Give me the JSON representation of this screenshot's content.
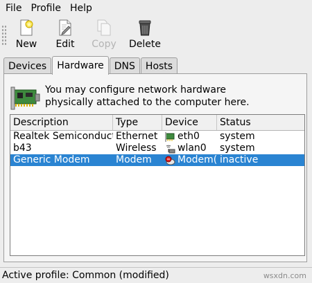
{
  "menubar": {
    "items": [
      "File",
      "Profile",
      "Help"
    ]
  },
  "toolbar": {
    "new": "New",
    "edit": "Edit",
    "copy": "Copy",
    "delete": "Delete"
  },
  "tabs": [
    "Devices",
    "Hardware",
    "DNS",
    "Hosts"
  ],
  "active_tab": "Hardware",
  "info": {
    "line1": "You may configure network hardware",
    "line2": "physically attached to the computer here."
  },
  "table": {
    "columns": [
      "Description",
      "Type",
      "Device",
      "Status"
    ],
    "rows": [
      {
        "description": "Realtek Semiconduct",
        "type": "Ethernet",
        "device": "eth0",
        "status": "system",
        "icon": "ethernet-card-icon"
      },
      {
        "description": "b43",
        "type": "Wireless",
        "device": "wlan0",
        "status": "system",
        "icon": "wireless-icon"
      },
      {
        "description": "Generic Modem",
        "type": "Modem",
        "device": "Modem(",
        "status": "inactive",
        "icon": "modem-icon",
        "selected": true
      }
    ]
  },
  "statusbar": {
    "text": "Active profile: Common (modified)",
    "watermark": "wsxdn.com"
  },
  "colors": {
    "selection": "#2a84d2",
    "background": "#ededed"
  }
}
